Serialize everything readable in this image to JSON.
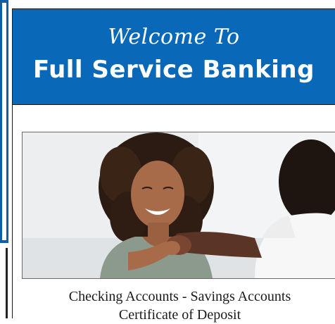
{
  "banner": {
    "welcome": "Welcome To",
    "title": "Full Service Banking"
  },
  "photo": {
    "subject": "handshake-photo"
  },
  "caption": {
    "line1": "Checking Accounts - Savings Accounts",
    "line2": "Certificate of Deposit"
  },
  "colors": {
    "banner": "#0a68b8",
    "text": "#1a1a1a"
  }
}
